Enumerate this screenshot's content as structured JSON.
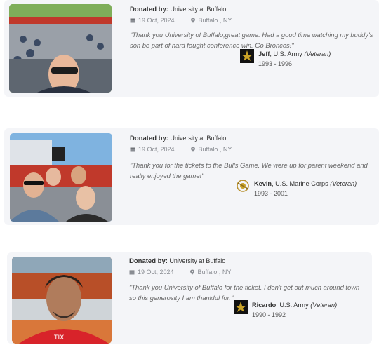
{
  "donations": [
    {
      "donated_label": "Donated by:",
      "donor": "University at Buffalo",
      "date": "19 Oct, 2024",
      "location": "Buffalo , NY",
      "quote": "\"Thank you University of Buffalo,great game. Had a good time watching my buddy's son be part of hard fought conference win. Go Broncos!\"",
      "veteran_name": "Jeff",
      "branch": ", U.S. Army ",
      "status": "(Veteran)",
      "years": "1993 - 1996",
      "badge_icon": "us-army-star-icon",
      "badge_text": "U.S.ARMY"
    },
    {
      "donated_label": "Donated by:",
      "donor": "University at Buffalo",
      "date": "19 Oct, 2024",
      "location": "Buffalo , NY",
      "quote": "\"Thank you for the tickets to the Bulls Game. We were up for parent weekend and really enjoyed the game!\"",
      "veteran_name": "Kevin",
      "branch": ", U.S. Marine Corps ",
      "status": "(Veteran)",
      "years": "1993 - 2001",
      "badge_icon": "marine-corps-emblem-icon",
      "badge_text": ""
    },
    {
      "donated_label": "Donated by:",
      "donor": "University at Buffalo",
      "date": "19 Oct, 2024",
      "location": "Buffalo , NY",
      "quote": "\"Thank you University of Buffalo for the ticket. I don't get out much around town so this generosity I am thankful for.\"",
      "veteran_name": "Ricardo",
      "branch": ", U.S. Army ",
      "status": "(Veteran)",
      "years": "1990 - 1992",
      "badge_icon": "us-army-star-icon",
      "badge_text": "U.S.ARMY"
    }
  ],
  "colors": {
    "card_bg": "#f4f5f8",
    "muted_text": "#8a8d93",
    "army_gold": "#c9a227"
  }
}
